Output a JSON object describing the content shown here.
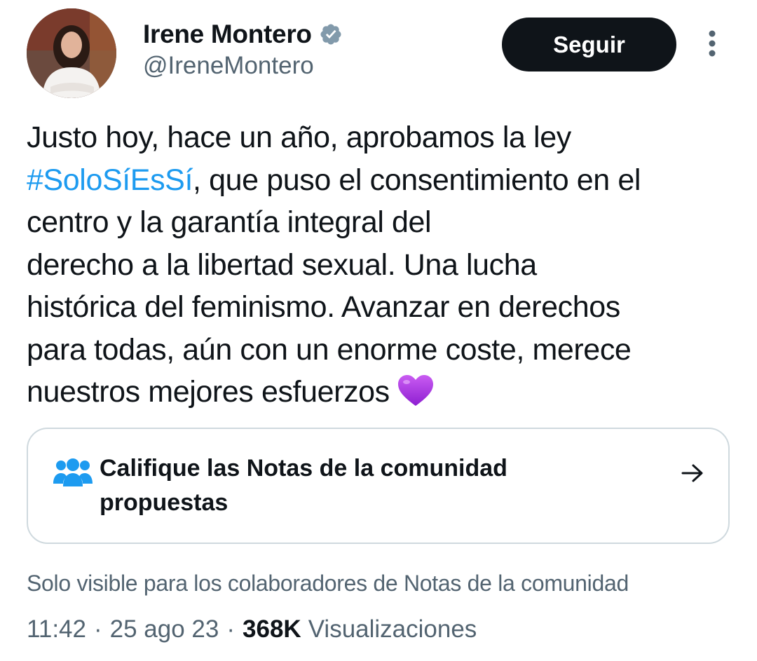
{
  "author": {
    "display_name": "Irene Montero",
    "handle": "@IreneMontero",
    "verified": true,
    "avatar_icon": "profile-photo"
  },
  "header": {
    "follow_label": "Seguir",
    "more_icon": "vertical-ellipsis-icon"
  },
  "tweet": {
    "lines": [
      {
        "parts": [
          {
            "text": "Justo hoy, hace un año, aprobamos la ley"
          }
        ]
      },
      {
        "parts": [
          {
            "text": "#SoloSíEsSí",
            "hashtag": true
          },
          {
            "text": ", que puso el consentimiento en el"
          }
        ]
      },
      {
        "parts": [
          {
            "text": "centro y la garantía integral del"
          }
        ]
      },
      {
        "parts": [
          {
            "text": "derecho a la libertad sexual. Una lucha"
          }
        ]
      },
      {
        "parts": [
          {
            "text": "histórica del feminismo. Avanzar en derechos"
          }
        ]
      },
      {
        "parts": [
          {
            "text": "para todas, aún con un enorme coste, merece"
          }
        ]
      },
      {
        "parts": [
          {
            "text": "nuestros mejores esfuerzos"
          }
        ],
        "emoji": "purple-heart"
      }
    ]
  },
  "community_notes": {
    "title": "Califique las Notas de la comunidad propuestas",
    "icon": "people-icon",
    "arrow_icon": "arrow-right-icon",
    "visibility_note": "Solo visible para los colaboradores de Notas de la comunidad"
  },
  "meta": {
    "time": "11:42",
    "separator": "·",
    "date": "25 ago 23",
    "views_count": "368K",
    "views_label": "Visualizaciones"
  },
  "colors": {
    "text": "#0f1419",
    "secondary": "#536471",
    "accent": "#1d9bf0",
    "border": "#cfd9de",
    "button_bg": "#0f1419"
  }
}
